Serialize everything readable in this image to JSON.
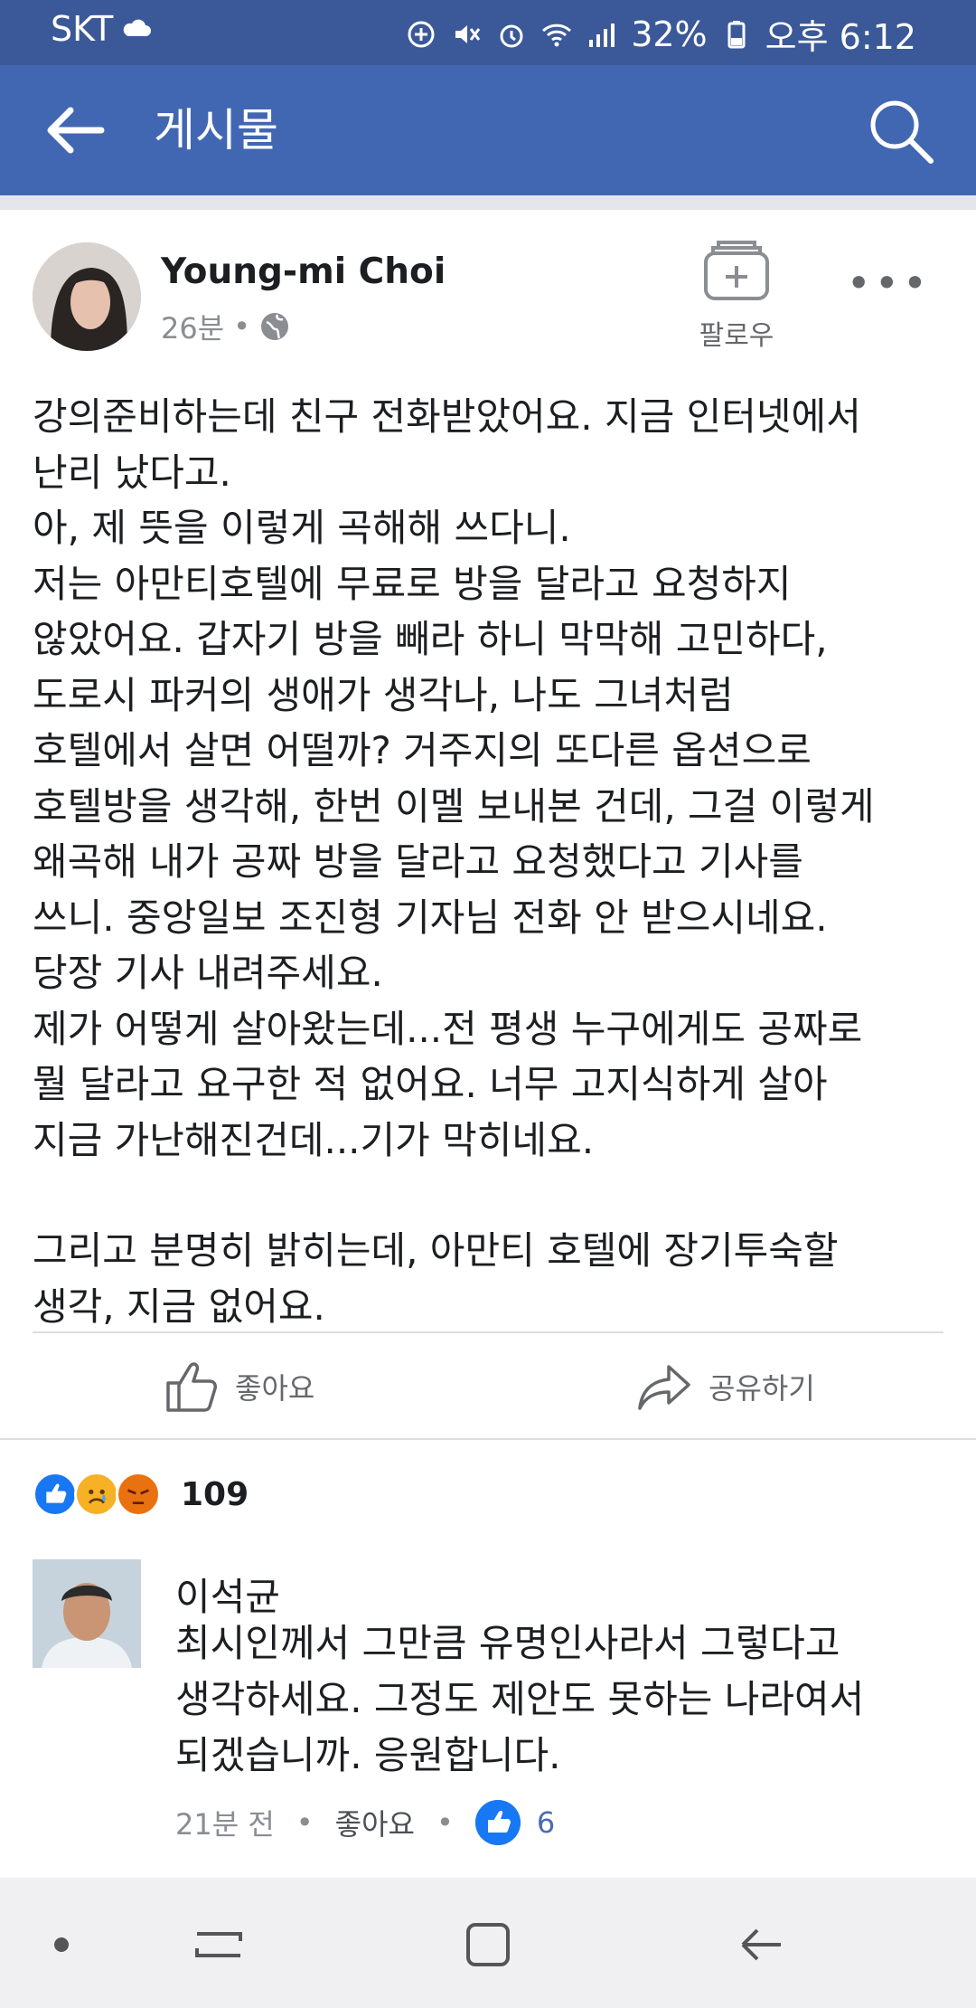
{
  "status_bar": {
    "carrier": "SKT",
    "battery": "32%",
    "time": "오후 6:12"
  },
  "app_bar": {
    "title": "게시물"
  },
  "post": {
    "author": "Young-mi Choi",
    "time": "26분",
    "dot": "•",
    "follow_label": "팔로우",
    "more_label": "•••",
    "paragraphs": [
      "강의준비하는데 친구 전화받았어요. 지금 인터넷에서\n난리 났다고.\n아, 제 뜻을 이렇게 곡해해 쓰다니.\n저는 아만티호텔에 무료로 방을 달라고 요청하지\n않았어요. 갑자기 방을 빼라 하니 막막해 고민하다,\n도로시 파커의 생애가 생각나, 나도 그녀처럼\n호텔에서 살면 어떨까? 거주지의 또다른 옵션으로\n호텔방을 생각해, 한번 이멜 보내본 건데, 그걸 이렇게\n왜곡해 내가 공짜 방을 달라고 요청했다고 기사를\n쓰니. 중앙일보 조진형 기자님 전화 안 받으시네요.\n당장 기사 내려주세요.\n제가 어떻게 살아왔는데...전 평생 누구에게도 공짜로\n뭘 달라고 요구한 적 없어요. 너무 고지식하게 살아\n지금 가난해진건데...기가 막히네요.",
      "그리고 분명히 밝히는데, 아만티 호텔에 장기투숙할\n생각, 지금 없어요."
    ]
  },
  "actions": {
    "like_label": "좋아요",
    "share_label": "공유하기"
  },
  "reactions": {
    "icons": [
      "like-reaction",
      "sad-reaction",
      "angry-reaction"
    ],
    "count": "109"
  },
  "comment": {
    "name": "이석균",
    "text": "최시인께서 그만큼 유명인사라서 그렇다고\n생각하세요. 그정도 제안도 못하는 나라여서\n되겠습니까. 응원합니다.",
    "time": "21분 전",
    "sep": "•",
    "like_label": "좋아요",
    "like_count": "6"
  },
  "colors": {
    "status_bar": "#3b5998",
    "app_bar": "#4267b2",
    "like_blue": "#1877f2"
  }
}
